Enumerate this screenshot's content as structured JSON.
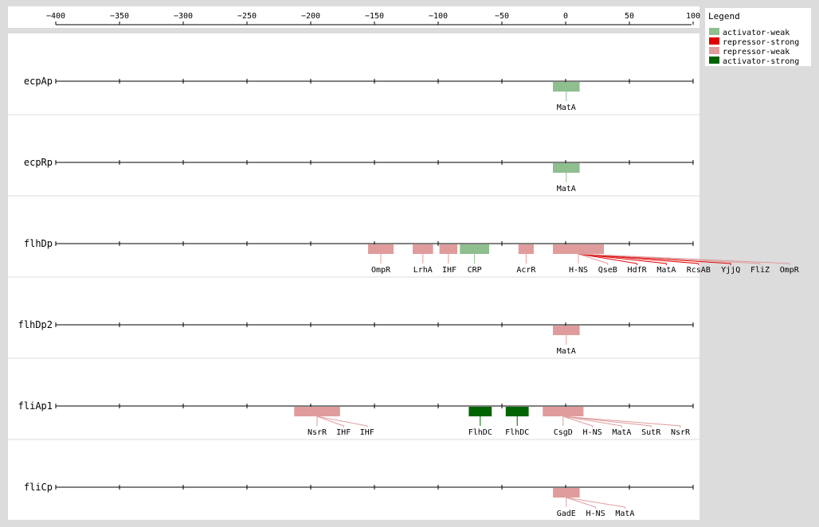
{
  "axis": {
    "ticks": [
      -400,
      -350,
      -300,
      -250,
      -200,
      -150,
      -100,
      -50,
      0,
      50,
      100
    ],
    "tick_labels": [
      "−400",
      "−350",
      "−300",
      "−250",
      "−200",
      "−150",
      "−100",
      "−50",
      "0",
      "50",
      "100"
    ],
    "range": [
      -400,
      100
    ]
  },
  "legend": {
    "title": "Legend",
    "items": [
      {
        "label": "activator-weak",
        "color": "#8fbf8f"
      },
      {
        "label": "repressor-strong",
        "color": "#e00000"
      },
      {
        "label": "repressor-weak",
        "color": "#e09c9c"
      },
      {
        "label": "activator-strong",
        "color": "#006400"
      }
    ]
  },
  "colors": {
    "activator-weak": "#8fbf8f",
    "repressor-strong": "#e00000",
    "repressor-weak": "#e09c9c",
    "activator-strong": "#006400"
  },
  "promoters": [
    {
      "name": "ecpAp",
      "sites": [
        {
          "start": -10,
          "end": 11,
          "type": "activator-weak"
        }
      ],
      "labels": [
        {
          "text": "MatA",
          "site": 0
        }
      ]
    },
    {
      "name": "ecpRp",
      "sites": [
        {
          "start": -10,
          "end": 11,
          "type": "activator-weak"
        }
      ],
      "labels": [
        {
          "text": "MatA",
          "site": 0
        }
      ]
    },
    {
      "name": "flhDp",
      "sites": [
        {
          "start": -155,
          "end": -135,
          "type": "repressor-weak"
        },
        {
          "start": -120,
          "end": -104,
          "type": "repressor-weak"
        },
        {
          "start": -99,
          "end": -85,
          "type": "repressor-weak"
        },
        {
          "start": -83,
          "end": -60,
          "type": "activator-weak"
        },
        {
          "start": -37,
          "end": -25,
          "type": "repressor-weak"
        },
        {
          "start": -10,
          "end": 30,
          "type": "repressor-weak"
        }
      ],
      "labels": [
        {
          "text": "OmpR",
          "site": 0
        },
        {
          "text": "LrhA",
          "site": 1
        },
        {
          "text": "IHF",
          "site": 2
        },
        {
          "text": "CRP",
          "site": 3
        },
        {
          "text": "AcrR",
          "site": 4
        },
        {
          "text": "H-NS",
          "site": 5
        },
        {
          "text": "QseB",
          "site": 5,
          "line": "repressor-weak"
        },
        {
          "text": "HdfR",
          "site": 5,
          "line": "repressor-strong"
        },
        {
          "text": "MatA",
          "site": 5,
          "line": "repressor-strong"
        },
        {
          "text": "RcsAB",
          "site": 5,
          "line": "repressor-strong"
        },
        {
          "text": "YjjQ",
          "site": 5,
          "line": "repressor-strong"
        },
        {
          "text": "FliZ",
          "site": 5,
          "line": "repressor-weak"
        },
        {
          "text": "OmpR",
          "site": 5,
          "line": "repressor-weak"
        }
      ]
    },
    {
      "name": "flhDp2",
      "sites": [
        {
          "start": -10,
          "end": 11,
          "type": "repressor-weak"
        }
      ],
      "labels": [
        {
          "text": "MatA",
          "site": 0
        }
      ]
    },
    {
      "name": "fliAp1",
      "sites": [
        {
          "start": -213,
          "end": -177,
          "type": "repressor-weak"
        },
        {
          "start": -76,
          "end": -58,
          "type": "activator-strong"
        },
        {
          "start": -47,
          "end": -29,
          "type": "activator-strong"
        },
        {
          "start": -18,
          "end": 14,
          "type": "repressor-weak"
        }
      ],
      "labels": [
        {
          "text": "NsrR",
          "site": 0
        },
        {
          "text": "IHF",
          "site": 0,
          "line": "repressor-weak"
        },
        {
          "text": "IHF",
          "site": 0,
          "line": "repressor-weak"
        },
        {
          "text": "FlhDC",
          "site": 1
        },
        {
          "text": "FlhDC",
          "site": 2
        },
        {
          "text": "CsgD",
          "site": 3
        },
        {
          "text": "H-NS",
          "site": 3,
          "line": "repressor-weak"
        },
        {
          "text": "MatA",
          "site": 3,
          "line": "repressor-weak"
        },
        {
          "text": "SutR",
          "site": 3,
          "line": "repressor-weak"
        },
        {
          "text": "NsrR",
          "site": 3,
          "line": "repressor-weak"
        }
      ]
    },
    {
      "name": "fliCp",
      "sites": [
        {
          "start": -10,
          "end": 11,
          "type": "repressor-weak"
        }
      ],
      "labels": [
        {
          "text": "GadE",
          "site": 0
        },
        {
          "text": "H-NS",
          "site": 0,
          "line": "repressor-weak"
        },
        {
          "text": "MatA",
          "site": 0,
          "line": "repressor-weak"
        }
      ]
    }
  ]
}
